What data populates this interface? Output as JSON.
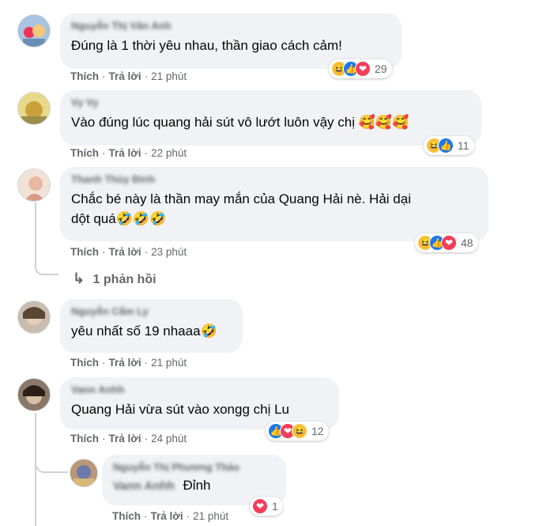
{
  "actions": {
    "like": "Thích",
    "reply": "Trả lời",
    "dot": "·"
  },
  "comments": [
    {
      "author": "Nguyễn Thị Vân Anh",
      "text": "Đúng là 1 thời yêu nhau, thần giao cách cảm!",
      "time": "21 phút",
      "reactions": [
        "haha",
        "like",
        "love"
      ],
      "reaction_count": "29",
      "avatar_color": "#a8c4e0"
    },
    {
      "author": "Vy Vy",
      "text": "Vào đúng lúc quang hải sút vô lướt luôn vậy chị 🥰🥰🥰",
      "time": "22 phút",
      "reactions": [
        "haha",
        "like"
      ],
      "reaction_count": "11",
      "avatar_color": "#d9c86a"
    },
    {
      "author": "Thanh Thùy Đinh",
      "text_line1": "Chắc bé này là thần may mắn của Quang Hải nè. Hải dại",
      "text_line2": "dột quá🤣🤣🤣",
      "time": "23 phút",
      "reactions": [
        "haha",
        "like",
        "love"
      ],
      "reaction_count": "48",
      "replies_link": "1 phản hồi",
      "avatar_color": "#e6c9b8"
    },
    {
      "author": "Nguyễn Cẩm Ly",
      "text": "yêu nhất số 19 nhaaa🤣",
      "time": "21 phút",
      "avatar_color": "#b8a898"
    },
    {
      "author": "Vann Anhh",
      "text": "Quang Hải vừa sút vào xongg chị Lu",
      "time": "24 phút",
      "reactions": [
        "like",
        "love",
        "haha"
      ],
      "reaction_count": "12",
      "avatar_color": "#6b5a4a"
    },
    {
      "author": "Nguyễn Thị Phương Thảo",
      "mention": "Vann Anhh",
      "text": "Đỉnh",
      "time": "21 phút",
      "reactions": [
        "love"
      ],
      "reaction_count": "1",
      "avatar_color": "#c8a070"
    }
  ],
  "icons": {
    "haha": "😆",
    "like": "👍",
    "love": "❤",
    "reply_arrow": "↳"
  }
}
